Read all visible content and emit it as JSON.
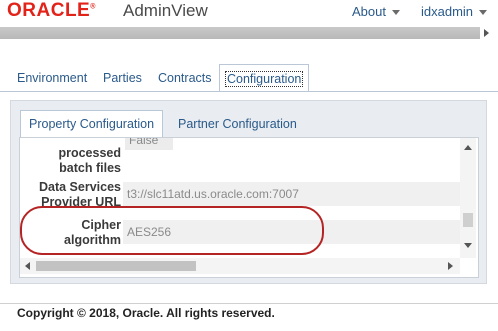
{
  "header": {
    "logo": "ORACLE",
    "registered_mark": "®",
    "app_title": "AdminView",
    "about_label": "About",
    "user_label": "idxadmin"
  },
  "top_tabs": [
    "Environment",
    "Parties",
    "Contracts",
    "Configuration"
  ],
  "active_top_tab": "Configuration",
  "sub_tabs": [
    "Property Configuration",
    "Partner Configuration"
  ],
  "active_sub_tab": "Property Configuration",
  "properties": [
    {
      "label_lines": [
        "processed",
        "batch files"
      ],
      "value": "False"
    },
    {
      "label_lines": [
        "Data Services",
        "Provider URL"
      ],
      "value": "t3://slc11atd.us.oracle.com:7007"
    },
    {
      "label_lines": [
        "Cipher",
        "algorithm"
      ],
      "value": "AES256"
    }
  ],
  "annotation": {
    "highlight_color": "#b52424"
  },
  "footer": {
    "copyright": "Copyright © 2018, Oracle. All rights reserved."
  },
  "colors": {
    "brand": "#e2231a",
    "link": "#2a5a8a"
  }
}
